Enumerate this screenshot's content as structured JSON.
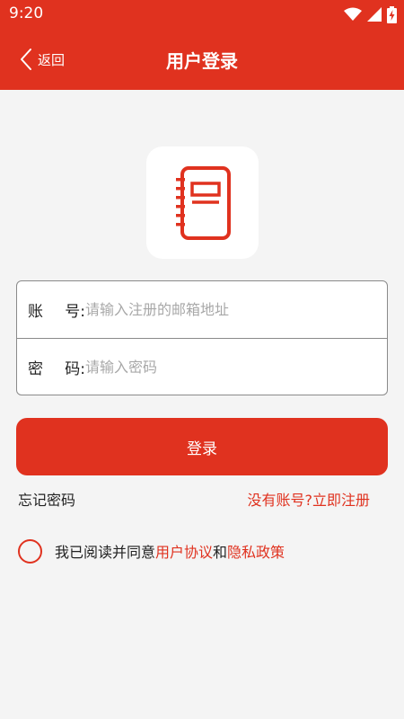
{
  "status_bar": {
    "time": "9:20",
    "icons": [
      "wifi-icon",
      "cellular-signal-icon",
      "battery-charging-icon"
    ]
  },
  "nav": {
    "back_label": "返回",
    "title": "用户登录"
  },
  "logo": {
    "icon": "notebook-icon"
  },
  "form": {
    "account_label_1": "账",
    "account_label_2": "号:",
    "account_placeholder": "请输入注册的邮箱地址",
    "account_value": "",
    "password_label_1": "密",
    "password_label_2": "码:",
    "password_placeholder": "请输入密码",
    "password_value": ""
  },
  "actions": {
    "login_label": "登录",
    "forgot_label": "忘记密码",
    "register_label": "没有账号?立即注册"
  },
  "agreement": {
    "prefix": "我已阅读并同意",
    "user_agreement": "用户协议",
    "conjunction": "和",
    "privacy_policy": "隐私政策",
    "checked": false
  },
  "colors": {
    "brand_red": "#e0321f",
    "background": "#f4f4f4",
    "border": "#8a8a8a"
  }
}
